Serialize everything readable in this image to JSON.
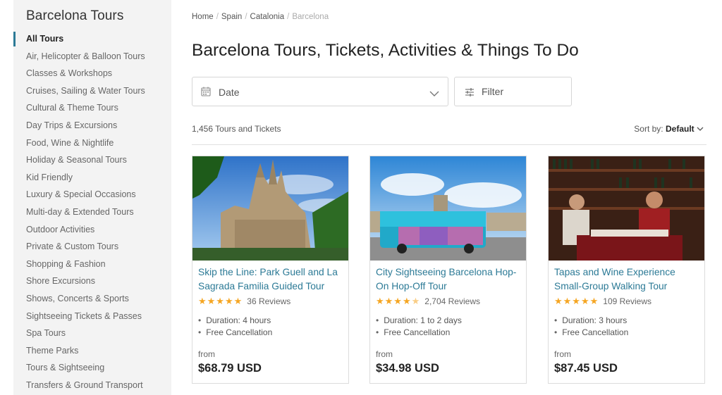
{
  "sidebar": {
    "title": "Barcelona Tours",
    "items": [
      {
        "label": "All Tours",
        "active": true
      },
      {
        "label": "Air, Helicopter & Balloon Tours"
      },
      {
        "label": "Classes & Workshops"
      },
      {
        "label": "Cruises, Sailing & Water Tours"
      },
      {
        "label": "Cultural & Theme Tours"
      },
      {
        "label": "Day Trips & Excursions"
      },
      {
        "label": "Food, Wine & Nightlife"
      },
      {
        "label": "Holiday & Seasonal Tours"
      },
      {
        "label": "Kid Friendly"
      },
      {
        "label": "Luxury & Special Occasions"
      },
      {
        "label": "Multi-day & Extended Tours"
      },
      {
        "label": "Outdoor Activities"
      },
      {
        "label": "Private & Custom Tours"
      },
      {
        "label": "Shopping & Fashion"
      },
      {
        "label": "Shore Excursions"
      },
      {
        "label": "Shows, Concerts & Sports"
      },
      {
        "label": "Sightseeing Tickets & Passes"
      },
      {
        "label": "Spa Tours"
      },
      {
        "label": "Theme Parks"
      },
      {
        "label": "Tours & Sightseeing"
      },
      {
        "label": "Transfers & Ground Transport"
      }
    ]
  },
  "breadcrumb": [
    "Home",
    "Spain",
    "Catalonia",
    "Barcelona"
  ],
  "page_title": "Barcelona Tours, Tickets, Activities & Things To Do",
  "filters": {
    "date_label": "Date",
    "filter_label": "Filter"
  },
  "results": {
    "count_text": "1,456 Tours and Tickets",
    "sort_label": "Sort by:",
    "sort_value": "Default"
  },
  "cards": [
    {
      "title": "Skip the Line: Park Guell and La Sagrada Familia Guided Tour",
      "rating": 5,
      "reviews": "36 Reviews",
      "duration": "Duration: 4 hours",
      "cancellation": "Free Cancellation",
      "from": "from",
      "price": "$68.79 USD",
      "image": "sagrada-familia-photo"
    },
    {
      "title": "City Sightseeing Barcelona Hop-On Hop-Off Tour",
      "rating": 4.5,
      "reviews": "2,704 Reviews",
      "duration": "Duration: 1 to 2 days",
      "cancellation": "Free Cancellation",
      "from": "from",
      "price": "$34.98 USD",
      "image": "hop-on-bus-photo"
    },
    {
      "title": "Tapas and Wine Experience Small-Group Walking Tour",
      "rating": 5,
      "reviews": "109 Reviews",
      "duration": "Duration: 3 hours",
      "cancellation": "Free Cancellation",
      "from": "from",
      "price": "$87.45 USD",
      "image": "wine-bar-photo"
    }
  ],
  "colors": {
    "accent": "#2c7a96",
    "star": "#f5a623",
    "sidebar_bg": "#f3f3f3"
  }
}
